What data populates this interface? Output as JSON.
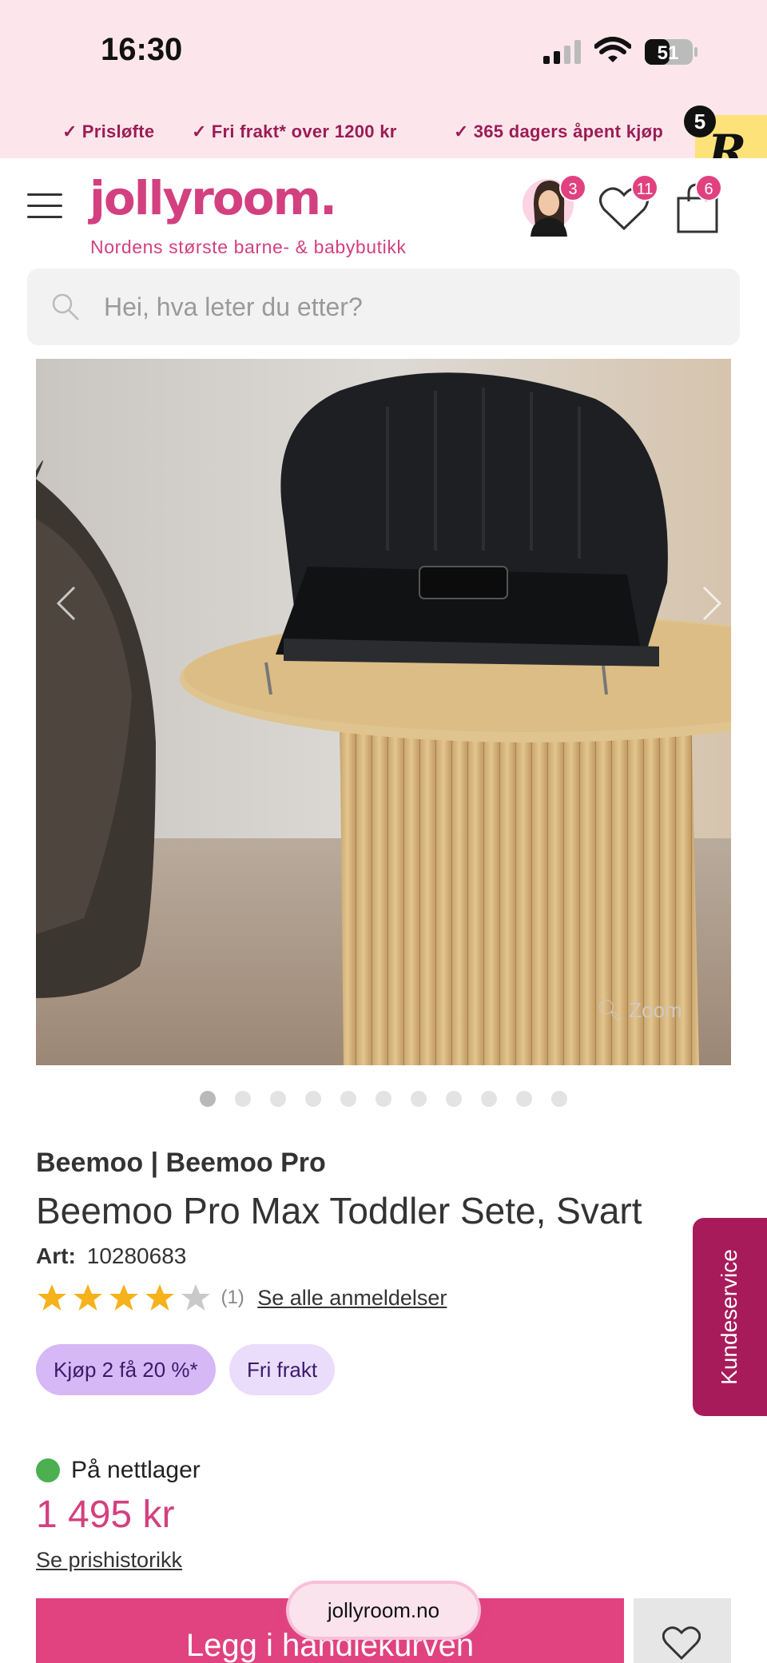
{
  "status_bar": {
    "time": "16:30",
    "battery": "51"
  },
  "promo": {
    "items": [
      "Prisløfte",
      "Fri frakt* over 1200 kr",
      "365 dagers åpent kjøp"
    ],
    "r_badge_letter": "R",
    "r_badge_count": "5"
  },
  "header": {
    "logo": "jollyroom.",
    "tagline": "Nordens største barne- & babybutikk",
    "avatar_badge": "3",
    "wishlist_badge": "11",
    "cart_badge": "6"
  },
  "search": {
    "placeholder": "Hei, hva leter du etter?"
  },
  "gallery": {
    "zoom_label": "Zoom",
    "dot_count": 11,
    "active_index": 0
  },
  "product": {
    "brand": "Beemoo | Beemoo Pro",
    "title": "Beemoo Pro Max Toddler Sete, Svart",
    "art_label": "Art:",
    "art_number": "10280683",
    "rating": 4,
    "rating_max": 5,
    "review_count": "(1)",
    "reviews_link": "Se alle anmeldelser",
    "tags": [
      "Kjøp 2 få 20 %*",
      "Fri frakt"
    ],
    "stock": "På nettlager",
    "price": "1 495 kr",
    "price_history": "Se prishistorikk",
    "cart_button": "Legg i handlekurven"
  },
  "overlay": {
    "site_pill": "jollyroom.no",
    "kundeservice": "Kundeservice"
  },
  "colors": {
    "brand_pink": "#d3407f",
    "promo_bg": "#fce6ec",
    "kundeservice_bg": "#a81b5a",
    "stock_green": "#4caf50",
    "star_gold": "#f6b21b"
  }
}
